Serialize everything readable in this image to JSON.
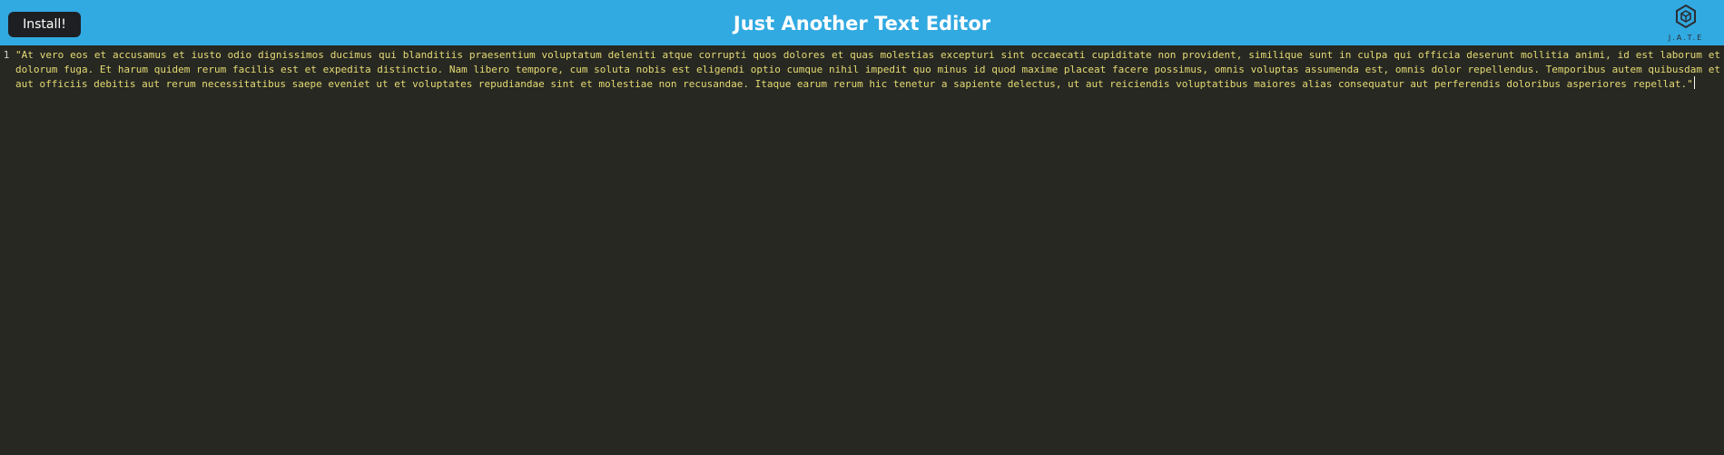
{
  "header": {
    "install_label": "Install!",
    "title": "Just Another Text Editor",
    "logo_text": "J.A.T.E",
    "background_color": "#31a9e1"
  },
  "editor": {
    "theme_background": "#272822",
    "text_color": "#e6db74",
    "lines": [
      {
        "number": "1",
        "text": "\"At vero eos et accusamus et iusto odio dignissimos ducimus qui blanditiis praesentium voluptatum deleniti atque corrupti quos dolores et quas molestias excepturi sint occaecati cupiditate non provident, similique sunt in culpa qui officia deserunt mollitia animi, id est laborum et dolorum fuga. Et harum quidem rerum facilis est et expedita distinctio. Nam libero tempore, cum soluta nobis est eligendi optio cumque nihil impedit quo minus id quod maxime placeat facere possimus, omnis voluptas assumenda est, omnis dolor repellendus. Temporibus autem quibusdam et aut officiis debitis aut rerum necessitatibus saepe eveniet ut et voluptates repudiandae sint et molestiae non recusandae. Itaque earum rerum hic tenetur a sapiente delectus, ut aut reiciendis voluptatibus maiores alias consequatur aut perferendis doloribus asperiores repellat.\""
      }
    ]
  },
  "icons": {
    "logo": "cube-logo-icon"
  }
}
